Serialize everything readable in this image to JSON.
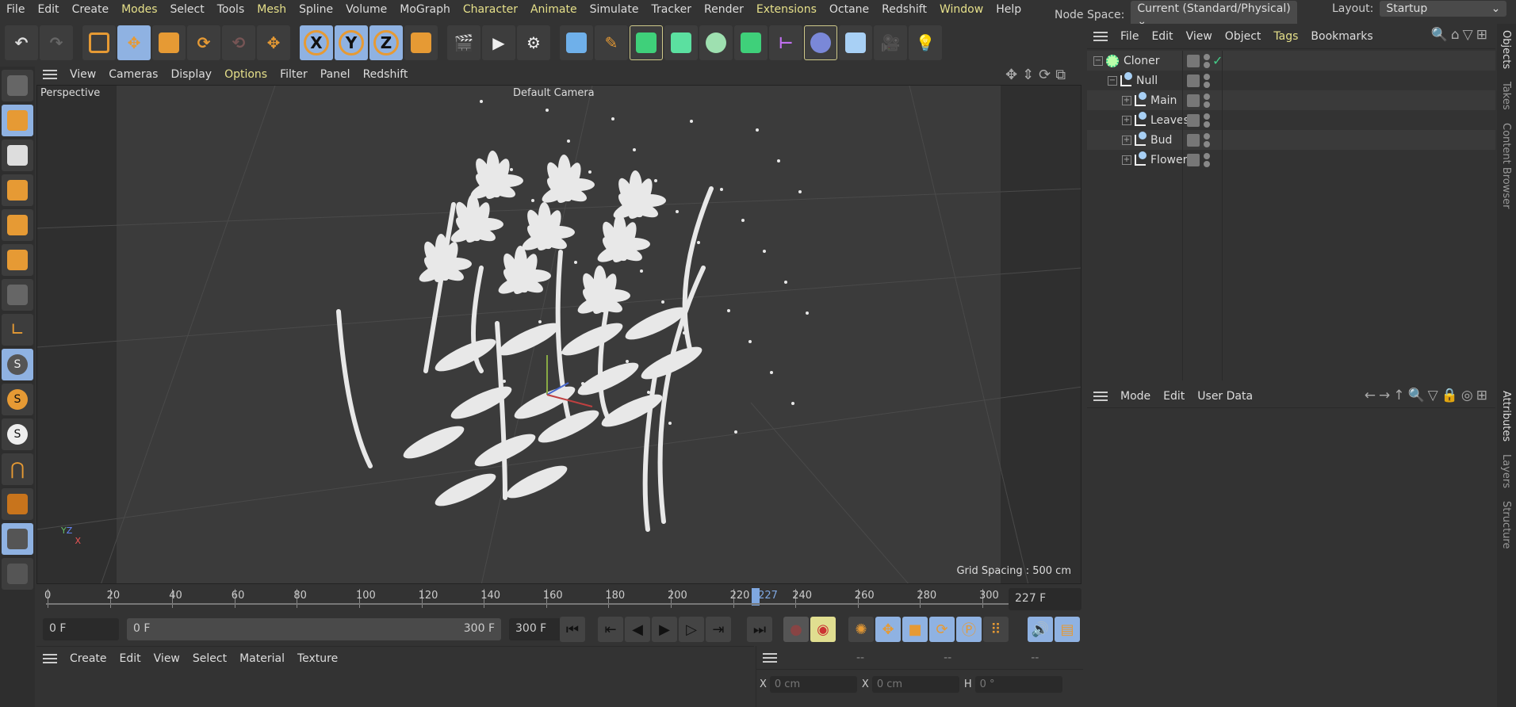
{
  "menu": [
    "File",
    "Edit",
    "Create",
    "Modes",
    "Select",
    "Tools",
    "Mesh",
    "Spline",
    "Volume",
    "MoGraph",
    "Character",
    "Animate",
    "Simulate",
    "Tracker",
    "Render",
    "Extensions",
    "Octane",
    "Redshift",
    "Window",
    "Help"
  ],
  "menu_highlighted": [
    "Modes",
    "Mesh",
    "Character",
    "Animate",
    "Extensions",
    "Window"
  ],
  "node_space": {
    "label": "Node Space:",
    "value": "Current (Standard/Physical)"
  },
  "layout": {
    "label": "Layout:",
    "value": "Startup"
  },
  "toolbar": {
    "axis_x": "X",
    "axis_y": "Y",
    "axis_z": "Z"
  },
  "viewport": {
    "menu": [
      "View",
      "Cameras",
      "Display",
      "Options",
      "Filter",
      "Panel",
      "Redshift"
    ],
    "view_name": "Perspective",
    "camera": "Default Camera",
    "grid_spacing": "Grid Spacing : 500 cm"
  },
  "timeline": {
    "ticks": [
      "0",
      "20",
      "40",
      "60",
      "80",
      "100",
      "120",
      "140",
      "160",
      "180",
      "200",
      "220",
      "240",
      "260",
      "280",
      "300"
    ],
    "current_frame": "227",
    "current_field": "227 F"
  },
  "transport": {
    "start": "0 F",
    "range_start": "0 F",
    "range_end": "300 F",
    "end": "300 F"
  },
  "material_manager": {
    "menu": [
      "Create",
      "Edit",
      "View",
      "Select",
      "Material",
      "Texture"
    ]
  },
  "coordinates": {
    "headers": [
      "--",
      "--",
      "--"
    ],
    "fields": [
      {
        "axis": "X",
        "value": "0 cm"
      },
      {
        "axis": "X",
        "value": "0 cm"
      },
      {
        "axis": "H",
        "value": "0 °"
      }
    ]
  },
  "object_manager": {
    "menu": [
      "File",
      "Edit",
      "View",
      "Object",
      "Tags",
      "Bookmarks"
    ],
    "objects": [
      {
        "name": "Cloner",
        "depth": 0
      },
      {
        "name": "Null",
        "depth": 1
      },
      {
        "name": "Main",
        "depth": 2
      },
      {
        "name": "Leaves",
        "depth": 2
      },
      {
        "name": "Bud",
        "depth": 2
      },
      {
        "name": "Flower",
        "depth": 2
      }
    ]
  },
  "attributes": {
    "menu": [
      "Mode",
      "Edit",
      "User Data"
    ]
  },
  "side_tabs": {
    "top": [
      "Objects",
      "Takes",
      "Content Browser"
    ],
    "bottom": [
      "Attributes",
      "Layers",
      "Structure"
    ]
  },
  "colors": {
    "accent_orange": "#e69a34",
    "selected_blue": "#8fb2e2",
    "highlight_menu": "#e6e08a",
    "playhead": "#7fa7e0"
  }
}
